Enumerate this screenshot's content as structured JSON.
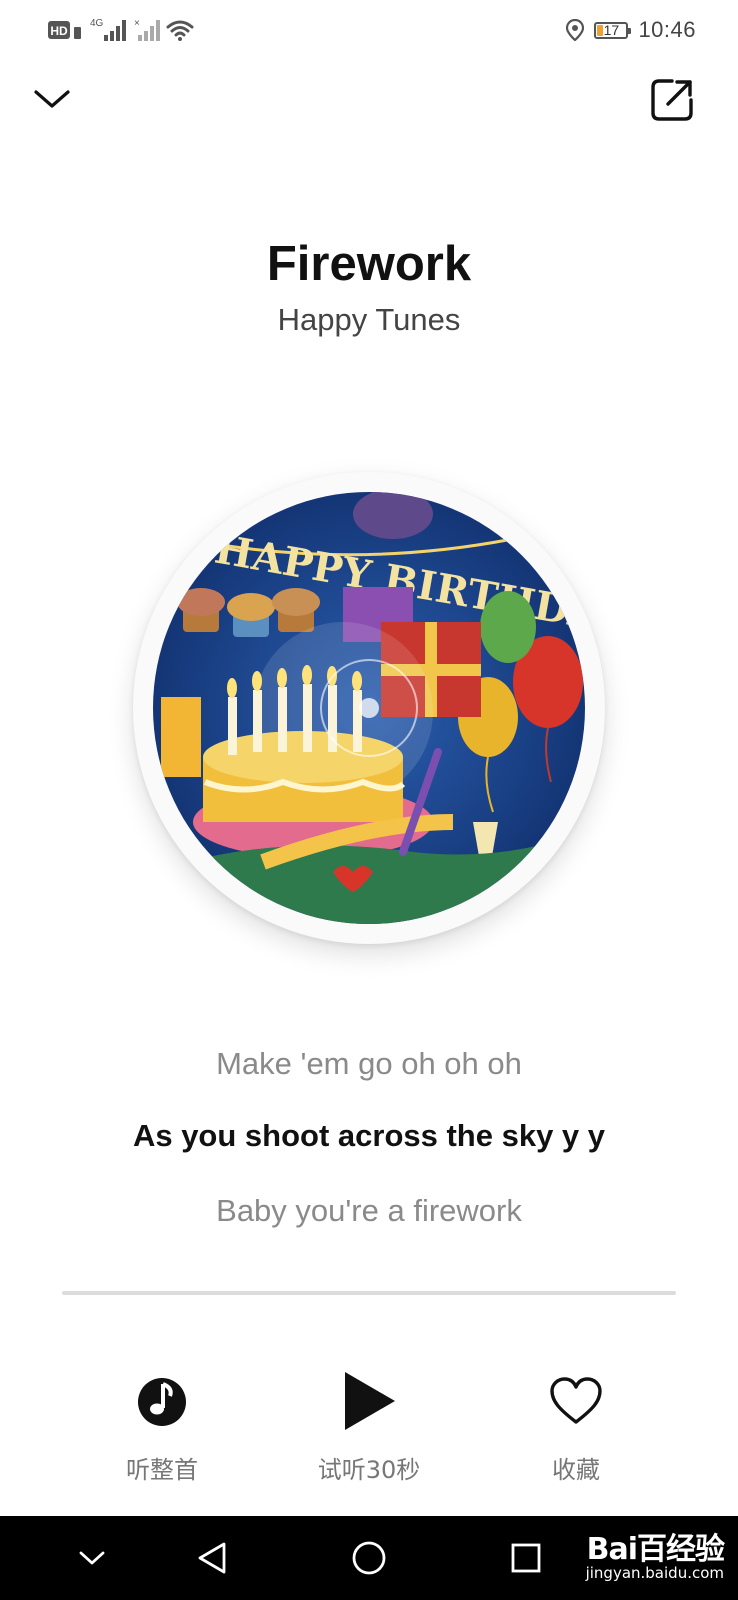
{
  "status_bar": {
    "hd_label": "HD",
    "network_label": "4G",
    "battery_level": 17,
    "battery_text": "17",
    "time": "10:46"
  },
  "top_bar": {
    "collapse_icon": "chevron-down-icon",
    "share_icon": "external-share-icon"
  },
  "song": {
    "title": "Firework",
    "artist": "Happy Tunes"
  },
  "cover": {
    "banner_text": "HAPPY BIRTHDAY"
  },
  "lyrics": {
    "previous": "Make 'em go oh oh oh",
    "current": "As you shoot across the sky y y",
    "next": "Baby you're a firework"
  },
  "progress": {
    "value": 0
  },
  "actions": {
    "full_song": {
      "label": "听整首",
      "icon": "music-note-icon"
    },
    "preview": {
      "label": "试听30秒",
      "icon": "play-icon"
    },
    "favorite": {
      "label": "收藏",
      "icon": "heart-icon"
    }
  },
  "nav_bar": {
    "watermark_brand": "Bai百经验",
    "watermark_url": "jingyan.baidu.com"
  },
  "colors": {
    "battery": "#f0a030",
    "nav_background": "#000000",
    "lyric_inactive": "#8a8a8a"
  }
}
